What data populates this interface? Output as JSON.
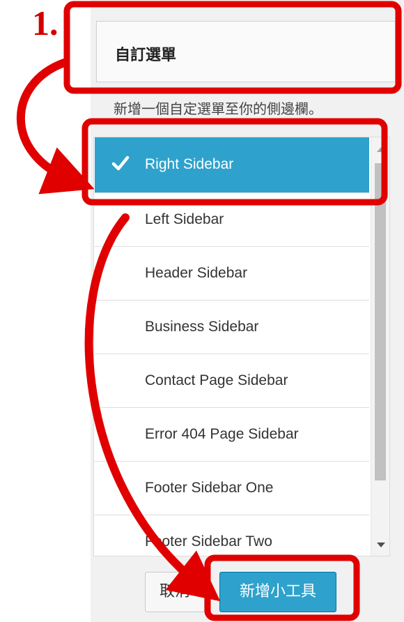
{
  "annotation": {
    "step_number": "1."
  },
  "widget": {
    "title": "自訂選單",
    "description": "新增一個自定選單至你的側邊欄。"
  },
  "sidebars": [
    {
      "label": "Right Sidebar",
      "selected": true
    },
    {
      "label": "Left Sidebar"
    },
    {
      "label": "Header Sidebar"
    },
    {
      "label": "Business Sidebar"
    },
    {
      "label": "Contact Page Sidebar"
    },
    {
      "label": "Error 404 Page Sidebar"
    },
    {
      "label": "Footer Sidebar One"
    },
    {
      "label": "Footer Sidebar Two"
    }
  ],
  "buttons": {
    "cancel": "取消",
    "add_widget": "新增小工具"
  },
  "colors": {
    "selected_bg": "#2ea2cc",
    "annotation_red": "#e00000"
  },
  "icons": {
    "selected": "check-icon"
  }
}
